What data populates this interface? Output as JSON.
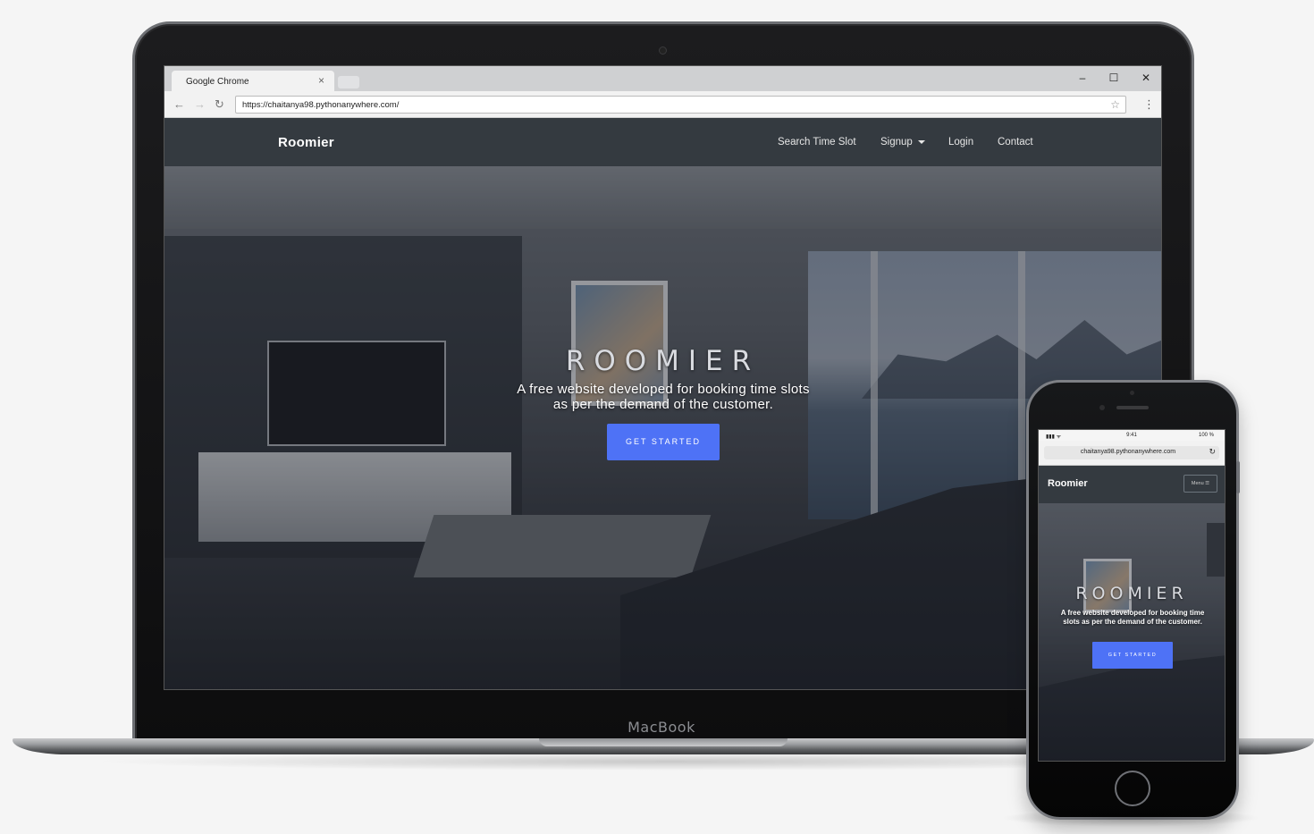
{
  "laptop": {
    "brand_label": "MacBook"
  },
  "browser": {
    "tab_title": "Google Chrome",
    "tab_close": "×",
    "url": "https://chaitanya98.pythonanywhere.com/",
    "window_controls": {
      "minimize": "–",
      "maximize": "☐",
      "close": "✕"
    },
    "nav": {
      "back": "←",
      "forward": "→",
      "reload": "↻",
      "star": "☆",
      "menu": "⋮"
    }
  },
  "site": {
    "brand": "Roomier",
    "nav_links": [
      "Search Time Slot",
      "Signup",
      "Login",
      "Contact"
    ],
    "hero_title": "ROOMIER",
    "hero_subtitle_line1": "A free website developed for booking time slots",
    "hero_subtitle_line2": "as per the demand of the customer.",
    "hero_button": "GET STARTED",
    "accent_color": "#4e72f6",
    "navbar_color": "#343a40"
  },
  "phone": {
    "status_time": "9:41",
    "status_battery": "100 %",
    "status_signal": "▮▮▮ ᯤ",
    "url": "chaitanya98.pythonanywhere.com",
    "reload": "↻",
    "brand": "Roomier",
    "menu_button": "Menu ☰",
    "hero_title": "ROOMIER",
    "hero_subtitle": "A free website developed for booking time slots as per the demand of the customer.",
    "hero_button": "GET STARTED"
  }
}
